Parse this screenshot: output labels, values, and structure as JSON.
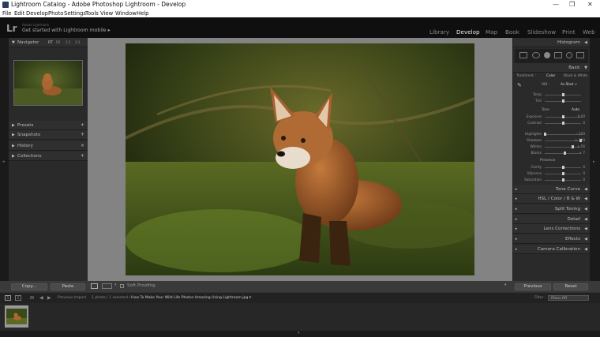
{
  "window": {
    "title": "Lightroom Catalog - Adobe Photoshop Lightroom - Develop",
    "controls": [
      "—",
      "❐",
      "✕"
    ]
  },
  "menu": [
    "File",
    "Edit",
    "Develop",
    "Photo",
    "Settings",
    "Tools",
    "View",
    "Window",
    "Help"
  ],
  "identity": {
    "logo": "Lr",
    "account": "Adobe Lightroom",
    "get_started": "Get started with Lightroom mobile ▸"
  },
  "modules": [
    "Library",
    "Develop",
    "Map",
    "Book",
    "Slideshow",
    "Print",
    "Web"
  ],
  "active_module": "Develop",
  "left_panel": {
    "navigator": {
      "label": "Navigator",
      "zoom": [
        "FIT",
        "Fill",
        "1:1",
        "3:1"
      ]
    },
    "sections": [
      "Presets",
      "Snapshots",
      "History",
      "Collections"
    ],
    "buttons": {
      "copy": "Copy...",
      "paste": "Paste"
    }
  },
  "right_panel": {
    "histogram": "Histogram",
    "basic": {
      "title": "Basic",
      "treatment_label": "Treatment :",
      "color": "Color",
      "bw": "Black & White",
      "wb_label": "WB :",
      "wb_value": "As Shot ÷",
      "temp": "Temp",
      "tint": "Tint",
      "tone_label": "Tone",
      "auto": "Auto",
      "exposure": "Exposure",
      "exposure_value": "0.00",
      "contrast": "Contrast",
      "contrast_value": "0",
      "highlights": "Highlights",
      "highlights_value": "– 100",
      "shadows": "Shadows",
      "shadows_value": "+ 100",
      "whites": "Whites",
      "whites_value": "+ 56",
      "blacks": "Blacks",
      "blacks_value": "+ 7",
      "presence_label": "Presence",
      "clarity": "Clarity",
      "clarity_value": "0",
      "vibrance": "Vibrance",
      "vibrance_value": "0",
      "saturation": "Saturation",
      "saturation_value": "0"
    },
    "sections": [
      "Tone Curve",
      "HSL / Color / B & W",
      "Split Toning",
      "Detail",
      "Lens Corrections",
      "Effects",
      "Camera Calibration"
    ],
    "buttons": {
      "previous": "Previous",
      "reset": "Reset"
    }
  },
  "toolbar": {
    "soft_proofing": "Soft Proofing"
  },
  "filmbar": {
    "pages": [
      "1",
      "2"
    ],
    "source": "Previous Import",
    "count": "1 photo / 1 selected /",
    "filename": "How To Make Your Wild Life Photos Amazing Using Lightroom.jpg ▾",
    "filter_label": "Filter :",
    "filter_value": "Filters Off"
  },
  "colors": {
    "accent": "#e8e8e8",
    "panel": "#2a2a2a",
    "background": "#838383"
  }
}
